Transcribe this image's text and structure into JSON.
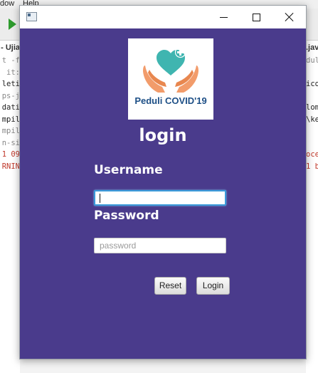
{
  "background_ide": {
    "menu": [
      "dow",
      "Help"
    ],
    "tab_title": "- Ujia",
    "tab_right": ".jav",
    "left_lines": [
      {
        "text": "t -f",
        "color": "#888888"
      },
      {
        "text": "it:",
        "color": "#888888"
      },
      {
        "text": "leti",
        "color": "#222222"
      },
      {
        "text": "ps-j",
        "color": "#888888"
      },
      {
        "text": "dati",
        "color": "#222222"
      },
      {
        "text": "mpil",
        "color": "#222222"
      },
      {
        "text": "mpil",
        "color": "#888888"
      },
      {
        "text": "n-si",
        "color": "#888888"
      },
      {
        "text": "1 09",
        "color": "#c0392b"
      },
      {
        "text": "RNIN",
        "color": "#c0392b"
      }
    ],
    "right_lines": [
      {
        "text": "dul",
        "color": "#888888"
      },
      {
        "text": "",
        "color": "#888888"
      },
      {
        "text": "ico",
        "color": "#222222"
      },
      {
        "text": "",
        "color": "#888888"
      },
      {
        "text": "lom",
        "color": "#222222"
      },
      {
        "text": "\\ke",
        "color": "#222222"
      },
      {
        "text": "",
        "color": "#888888"
      },
      {
        "text": "",
        "color": "#888888"
      },
      {
        "text": "oce",
        "color": "#c0392b"
      },
      {
        "text": "1 b",
        "color": "#c0392b"
      }
    ]
  },
  "window": {
    "controls": {
      "minimize": "minimize",
      "maximize": "maximize",
      "close": "close"
    }
  },
  "form": {
    "logo_text": "Peduli COVID'19",
    "heading": "login",
    "username_label": "Username",
    "username_value": "",
    "password_label": "Password",
    "password_placeholder": "password",
    "reset_button": "Reset",
    "login_button": "Login"
  },
  "colors": {
    "panel_background": "#4a3b8c",
    "focus_border": "#3a9ad9",
    "logo_text": "#1d4f86"
  }
}
